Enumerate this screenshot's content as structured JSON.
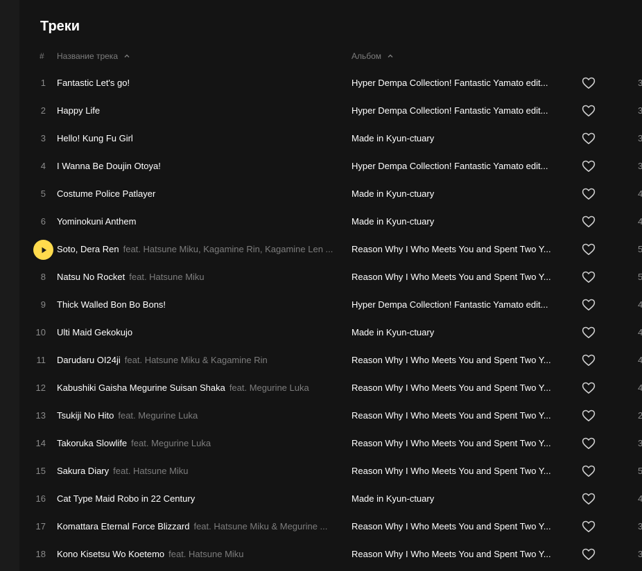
{
  "section": {
    "title": "Треки"
  },
  "columns": {
    "num": "#",
    "title": "Название трека",
    "album": "Альбом"
  },
  "icons": {
    "sort": "chevron-up-icon",
    "like": "heart-icon",
    "play": "play-icon"
  },
  "colors": {
    "accent": "#ffdb4d",
    "text": "#ffffff",
    "muted": "#7d7d7d",
    "background": "#141414"
  },
  "tracks": [
    {
      "num": "1",
      "title": "Fantastic Let's go!",
      "feat": "",
      "album": "Hyper Dempa Collection! Fantastic Yamato edit...",
      "duration": "3",
      "playing": false
    },
    {
      "num": "2",
      "title": "Happy Life",
      "feat": "",
      "album": "Hyper Dempa Collection! Fantastic Yamato edit...",
      "duration": "3",
      "playing": false
    },
    {
      "num": "3",
      "title": "Hello! Kung Fu Girl",
      "feat": "",
      "album": "Made in Kyun-ctuary",
      "duration": "3",
      "playing": false
    },
    {
      "num": "4",
      "title": "I Wanna Be Doujin Otoya!",
      "feat": "",
      "album": "Hyper Dempa Collection! Fantastic Yamato edit...",
      "duration": "3",
      "playing": false
    },
    {
      "num": "5",
      "title": "Costume Police Patlayer",
      "feat": "",
      "album": "Made in Kyun-ctuary",
      "duration": "4",
      "playing": false
    },
    {
      "num": "6",
      "title": "Yominokuni Anthem",
      "feat": "",
      "album": "Made in Kyun-ctuary",
      "duration": "4",
      "playing": false
    },
    {
      "num": "7",
      "title": "Soto, Dera Ren",
      "feat": "feat. Hatsune Miku, Kagamine Rin, Kagamine Len ...",
      "album": "Reason Why I Who Meets You and Spent Two Y...",
      "duration": "5",
      "playing": true
    },
    {
      "num": "8",
      "title": "Natsu No Rocket",
      "feat": "feat. Hatsune Miku",
      "album": "Reason Why I Who Meets You and Spent Two Y...",
      "duration": "5",
      "playing": false
    },
    {
      "num": "9",
      "title": "Thick Walled Bon Bo Bons!",
      "feat": "",
      "album": "Hyper Dempa Collection! Fantastic Yamato edit...",
      "duration": "4",
      "playing": false
    },
    {
      "num": "10",
      "title": "Ulti Maid Gekokujo",
      "feat": "",
      "album": "Made in Kyun-ctuary",
      "duration": "4",
      "playing": false
    },
    {
      "num": "11",
      "title": "Darudaru OI24ji",
      "feat": "feat. Hatsune Miku & Kagamine Rin",
      "album": "Reason Why I Who Meets You and Spent Two Y...",
      "duration": "4",
      "playing": false
    },
    {
      "num": "12",
      "title": "Kabushiki Gaisha Megurine Suisan Shaka",
      "feat": "feat. Megurine Luka",
      "album": "Reason Why I Who Meets You and Spent Two Y...",
      "duration": "4",
      "playing": false
    },
    {
      "num": "13",
      "title": "Tsukiji No Hito",
      "feat": "feat. Megurine Luka",
      "album": "Reason Why I Who Meets You and Spent Two Y...",
      "duration": "2",
      "playing": false
    },
    {
      "num": "14",
      "title": "Takoruka Slowlife",
      "feat": "feat. Megurine Luka",
      "album": "Reason Why I Who Meets You and Spent Two Y...",
      "duration": "3",
      "playing": false
    },
    {
      "num": "15",
      "title": "Sakura Diary",
      "feat": "feat. Hatsune Miku",
      "album": "Reason Why I Who Meets You and Spent Two Y...",
      "duration": "5",
      "playing": false
    },
    {
      "num": "16",
      "title": "Cat Type Maid Robo in 22 Century",
      "feat": "",
      "album": "Made in Kyun-ctuary",
      "duration": "4",
      "playing": false
    },
    {
      "num": "17",
      "title": "Komattara Eternal Force Blizzard",
      "feat": "feat. Hatsune Miku & Megurine ...",
      "album": "Reason Why I Who Meets You and Spent Two Y...",
      "duration": "3",
      "playing": false
    },
    {
      "num": "18",
      "title": "Kono Kisetsu Wo Koetemo",
      "feat": "feat. Hatsune Miku",
      "album": "Reason Why I Who Meets You and Spent Two Y...",
      "duration": "3",
      "playing": false
    }
  ]
}
